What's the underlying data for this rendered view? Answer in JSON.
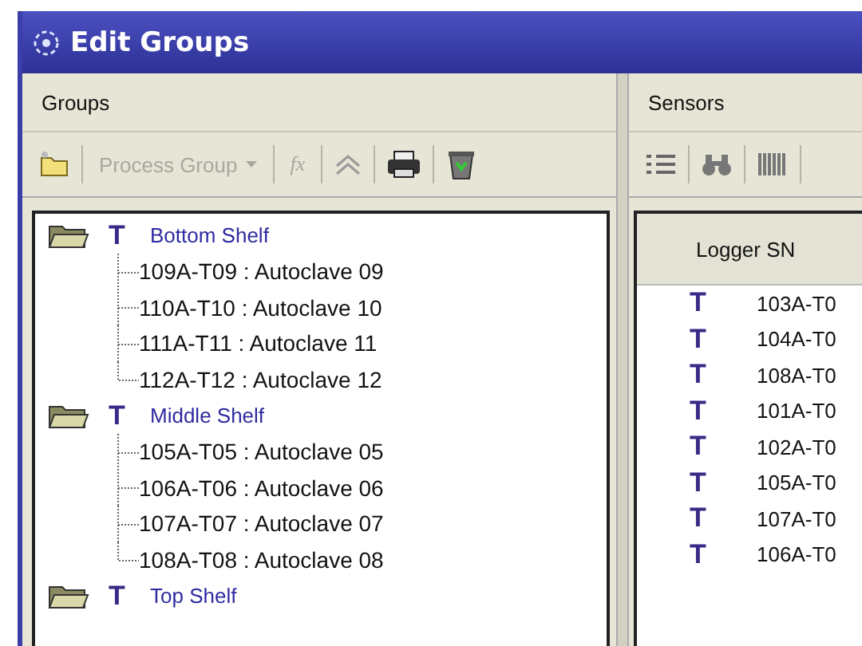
{
  "window": {
    "title": "Edit Groups"
  },
  "groups_panel": {
    "title": "Groups",
    "toolbar": {
      "process_group": {
        "label": "Process Group",
        "disabled": true
      },
      "fx": {
        "label": "fx",
        "disabled": true
      }
    },
    "tree": [
      {
        "type_mark": "T",
        "label": "Bottom Shelf",
        "children": [
          {
            "label": "109A-T09 : Autoclave 09"
          },
          {
            "label": "110A-T10 : Autoclave 10"
          },
          {
            "label": "111A-T11 : Autoclave 11"
          },
          {
            "label": "112A-T12 : Autoclave 12"
          }
        ]
      },
      {
        "type_mark": "T",
        "label": "Middle Shelf",
        "children": [
          {
            "label": "105A-T05 : Autoclave 05"
          },
          {
            "label": "106A-T06 : Autoclave 06"
          },
          {
            "label": "107A-T07 : Autoclave 07"
          },
          {
            "label": "108A-T08 : Autoclave 08"
          }
        ]
      },
      {
        "type_mark": "T",
        "label": "Top Shelf"
      }
    ]
  },
  "sensors_panel": {
    "title": "Sensors",
    "table": {
      "columns": [
        "Logger SN"
      ],
      "rows": [
        {
          "type_mark": "T",
          "logger_sn": "103A-T0"
        },
        {
          "type_mark": "T",
          "logger_sn": "104A-T0"
        },
        {
          "type_mark": "T",
          "logger_sn": "108A-T0"
        },
        {
          "type_mark": "T",
          "logger_sn": "101A-T0"
        },
        {
          "type_mark": "T",
          "logger_sn": "102A-T0"
        },
        {
          "type_mark": "T",
          "logger_sn": "105A-T0"
        },
        {
          "type_mark": "T",
          "logger_sn": "107A-T0"
        },
        {
          "type_mark": "T",
          "logger_sn": "106A-T0"
        }
      ]
    }
  }
}
